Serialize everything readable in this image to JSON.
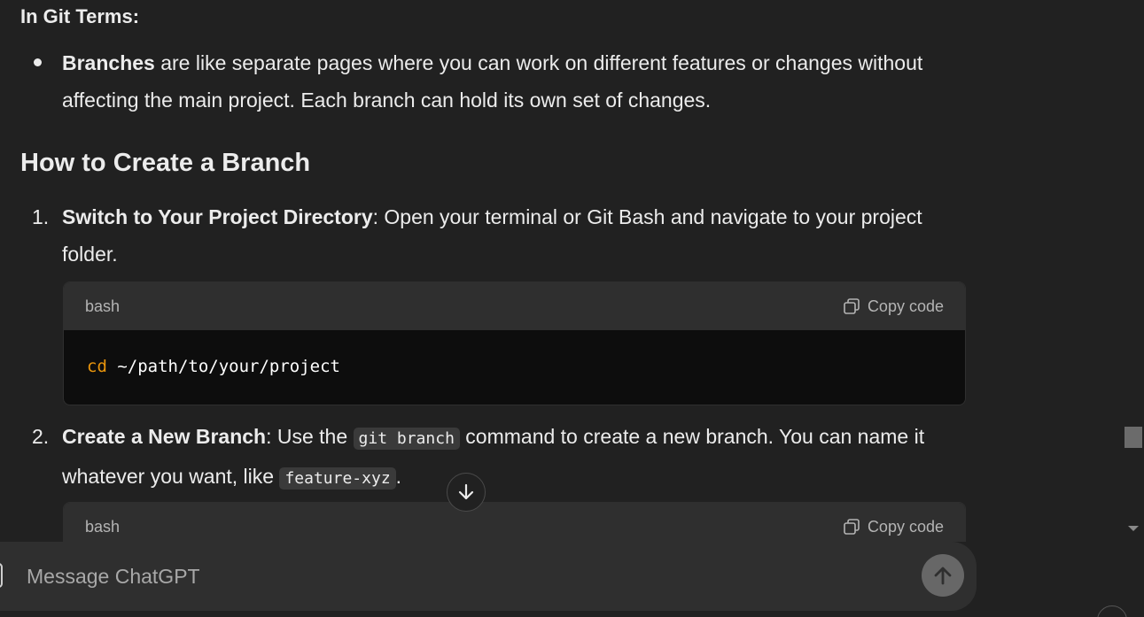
{
  "sections": {
    "git_terms_heading": "In Git Terms:",
    "bullet": {
      "bold": "Branches",
      "text": " are like separate pages where you can work on different features or changes without affecting the main project. Each branch can hold its own set of changes."
    },
    "create_heading": "How to Create a Branch"
  },
  "steps": [
    {
      "number": "1.",
      "bold": "Switch to Your Project Directory",
      "text": ": Open your terminal or Git Bash and navigate to your project folder."
    },
    {
      "number": "2.",
      "bold": "Create a New Branch",
      "text_a": ": Use the ",
      "code_a": "git branch",
      "text_b": " command to create a new branch. You can name it whatever you want, like ",
      "code_b": "feature-xyz",
      "text_c": "."
    }
  ],
  "code_blocks": [
    {
      "lang": "bash",
      "copy_label": "Copy code",
      "keyword": "cd",
      "rest": " ~/path/to/your/project"
    },
    {
      "lang": "bash",
      "copy_label": "Copy code"
    }
  ],
  "composer": {
    "placeholder": "Message ChatGPT"
  },
  "icons": {
    "copy": "copy-icon",
    "scroll_down": "arrow-down-icon",
    "send": "arrow-up-icon"
  },
  "colors": {
    "background": "#212121",
    "code_keyword": "#e9950c",
    "code_header": "#2f2f2f",
    "code_body": "#0d0d0d"
  }
}
